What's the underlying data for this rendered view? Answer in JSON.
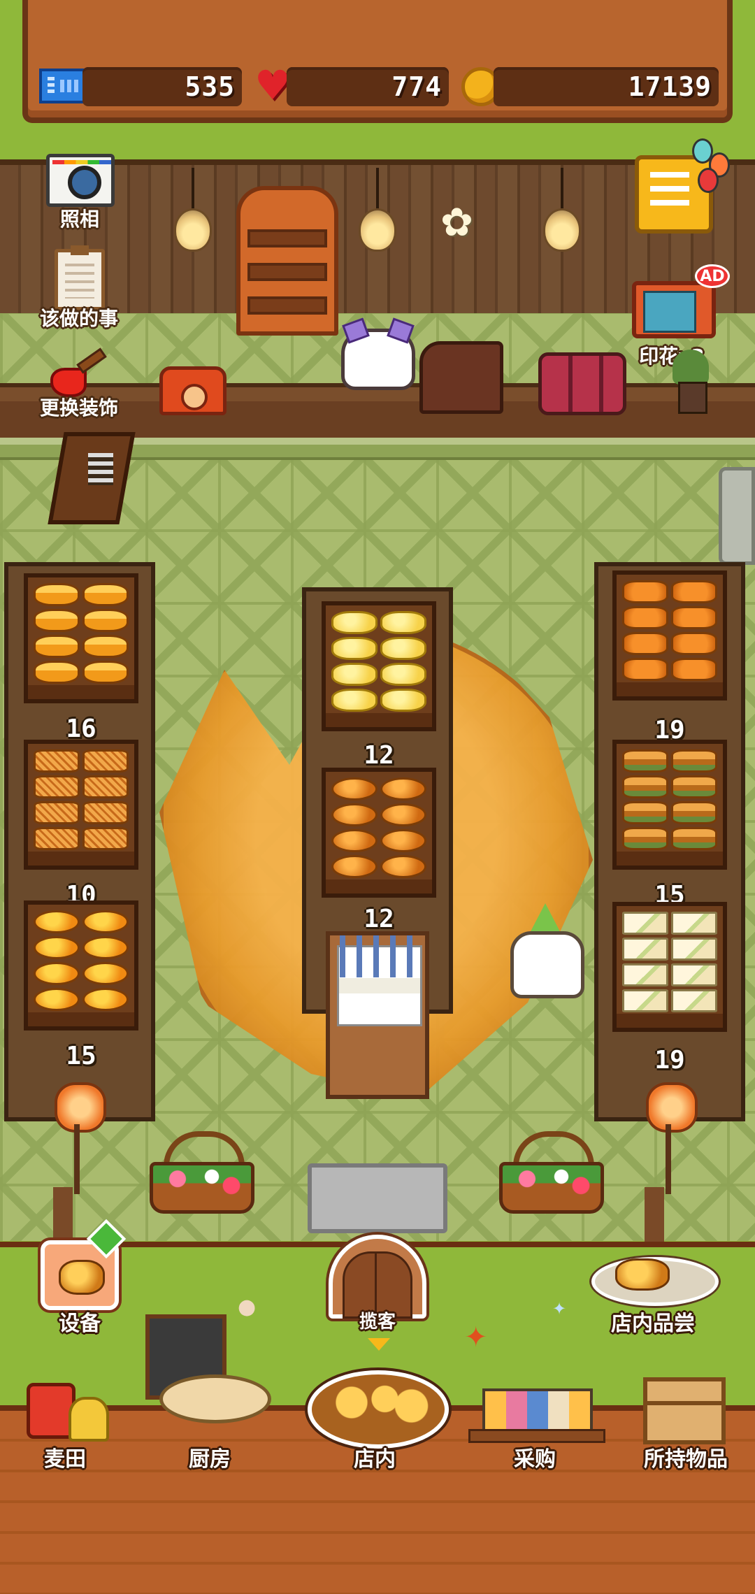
{
  "header": {
    "tickets": "535",
    "hearts": "774",
    "coins": "17139"
  },
  "left_menu": {
    "camera_label": "照相",
    "todo_label": "该做的事",
    "decorate_label": "更换装饰"
  },
  "right_menu": {
    "stamp_label": "印花x3",
    "ad_badge": "AD"
  },
  "shelves": {
    "left": [
      {
        "bread": "b-loaf",
        "count": "16"
      },
      {
        "bread": "b-waffle",
        "count": "10"
      },
      {
        "bread": "b-bun",
        "count": "15"
      }
    ],
    "center": [
      {
        "bread": "b-melon",
        "count": "12"
      },
      {
        "bread": "b-choco",
        "count": "12"
      }
    ],
    "right": [
      {
        "bread": "b-bear",
        "count": "19"
      },
      {
        "bread": "b-bar",
        "count": "15"
      },
      {
        "bread": "b-sand",
        "count": "19"
      }
    ]
  },
  "actions": {
    "equipment_label": "设备",
    "invite_label": "揽客",
    "tasting_label": "店内品尝"
  },
  "bottom_nav": {
    "items": [
      {
        "label": "麦田",
        "icon": "wheat-field-icon"
      },
      {
        "label": "厨房",
        "icon": "kitchen-icon"
      },
      {
        "label": "店内",
        "icon": "store-icon",
        "selected": true
      },
      {
        "label": "采购",
        "icon": "shop-icon"
      },
      {
        "label": "所持物品",
        "icon": "inventory-icon"
      }
    ]
  },
  "colors": {
    "grass": "#8fb83a",
    "wood": "#b8652e",
    "floor": "#a9bb6e",
    "croissant": "#f6b14a"
  }
}
